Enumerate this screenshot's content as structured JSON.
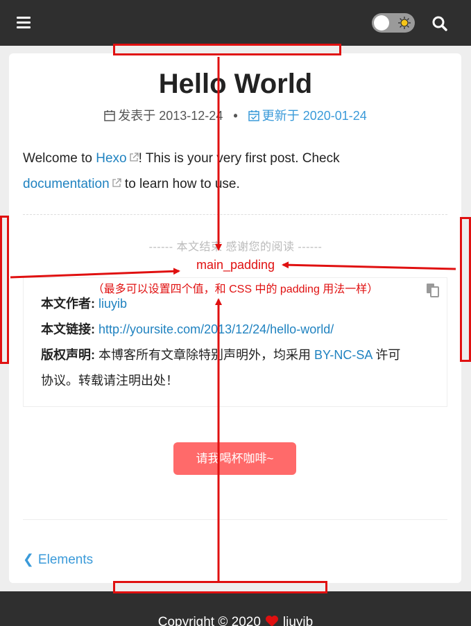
{
  "header": {
    "menu_icon": "hamburger-menu-icon",
    "theme_toggle_icon": "sun-icon",
    "search_icon": "search-icon"
  },
  "post": {
    "title": "Hello World",
    "published_label": "发表于",
    "published_date": "2013-12-24",
    "separator": "•",
    "updated_label": "更新于",
    "updated_date": "2020-01-24",
    "body": {
      "p1_before": "Welcome to ",
      "p1_link": "Hexo",
      "p1_after": "! This is your very first post. Check",
      "p2_link": "documentation",
      "p2_after": " to learn how to use."
    },
    "end_message": "------ 本文结束 感谢您的阅读 ------"
  },
  "copyright": {
    "author_label": "本文作者:",
    "author_value": "liuyib",
    "link_label": "本文链接:",
    "link_value": "http://yoursite.com/2013/12/24/hello-world/",
    "license_label": "版权声明:",
    "license_before": "本博客所有文章除特别声明外，均采用",
    "license_link": "BY-NC-SA",
    "license_after": "许可",
    "license_line2": "协议。转载请注明出处！"
  },
  "donate": {
    "label": "请我喝杯咖啡~"
  },
  "nav": {
    "prev_label": "Elements"
  },
  "footer": {
    "prefix": "Copyright © 2020",
    "author": "liuyib"
  },
  "annotation": {
    "title": "main_padding",
    "subtitle": "（最多可以设置四个值，和 CSS 中的 padding 用法一样）",
    "color": "#e01010"
  },
  "colors": {
    "header_bg": "#2f2f2f",
    "link": "#1f82c0",
    "accent": "#3a9ad9",
    "donate_bg": "#ff6a6a"
  }
}
